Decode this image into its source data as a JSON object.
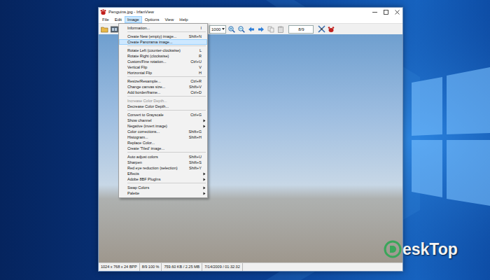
{
  "window": {
    "title": "Penguins.jpg - IrfanView"
  },
  "menubar": [
    {
      "label": "File",
      "selected": false
    },
    {
      "label": "Edit",
      "selected": false
    },
    {
      "label": "Image",
      "selected": true
    },
    {
      "label": "Options",
      "selected": false
    },
    {
      "label": "View",
      "selected": false
    },
    {
      "label": "Help",
      "selected": false
    }
  ],
  "toolbar": {
    "zoom": "1000",
    "page": "8/9"
  },
  "image_menu": [
    {
      "kind": "item",
      "label": "Information...",
      "shortcut": "I",
      "submenu": false,
      "disabled": false,
      "selected": false
    },
    {
      "kind": "separator"
    },
    {
      "kind": "item",
      "label": "Create New (empty) image...",
      "shortcut": "Shift+N",
      "submenu": false,
      "disabled": false,
      "selected": false
    },
    {
      "kind": "item",
      "label": "Create Panorama image...",
      "shortcut": "",
      "submenu": false,
      "disabled": false,
      "selected": true
    },
    {
      "kind": "separator"
    },
    {
      "kind": "item",
      "label": "Rotate Left (counter-clockwise)",
      "shortcut": "L",
      "submenu": false,
      "disabled": false,
      "selected": false
    },
    {
      "kind": "item",
      "label": "Rotate Right (clockwise)",
      "shortcut": "R",
      "submenu": false,
      "disabled": false,
      "selected": false
    },
    {
      "kind": "item",
      "label": "Custom/Fine rotation...",
      "shortcut": "Ctrl+U",
      "submenu": false,
      "disabled": false,
      "selected": false
    },
    {
      "kind": "item",
      "label": "Vertical Flip",
      "shortcut": "V",
      "submenu": false,
      "disabled": false,
      "selected": false
    },
    {
      "kind": "item",
      "label": "Horizontal Flip",
      "shortcut": "H",
      "submenu": false,
      "disabled": false,
      "selected": false
    },
    {
      "kind": "separator"
    },
    {
      "kind": "item",
      "label": "Resize/Resample...",
      "shortcut": "Ctrl+R",
      "submenu": false,
      "disabled": false,
      "selected": false
    },
    {
      "kind": "item",
      "label": "Change canvas size...",
      "shortcut": "Shift+V",
      "submenu": false,
      "disabled": false,
      "selected": false
    },
    {
      "kind": "item",
      "label": "Add border/frame...",
      "shortcut": "Ctrl+D",
      "submenu": false,
      "disabled": false,
      "selected": false
    },
    {
      "kind": "separator"
    },
    {
      "kind": "item",
      "label": "Increase Color Depth...",
      "shortcut": "",
      "submenu": false,
      "disabled": true,
      "selected": false
    },
    {
      "kind": "item",
      "label": "Decrease Color Depth...",
      "shortcut": "",
      "submenu": false,
      "disabled": false,
      "selected": false
    },
    {
      "kind": "separator"
    },
    {
      "kind": "item",
      "label": "Convert to Grayscale",
      "shortcut": "Ctrl+G",
      "submenu": false,
      "disabled": false,
      "selected": false
    },
    {
      "kind": "item",
      "label": "Show channel",
      "shortcut": "",
      "submenu": true,
      "disabled": false,
      "selected": false
    },
    {
      "kind": "item",
      "label": "Negative (invert image)",
      "shortcut": "",
      "submenu": true,
      "disabled": false,
      "selected": false
    },
    {
      "kind": "item",
      "label": "Color corrections...",
      "shortcut": "Shift+G",
      "submenu": false,
      "disabled": false,
      "selected": false
    },
    {
      "kind": "item",
      "label": "Histogram...",
      "shortcut": "Shift+H",
      "submenu": false,
      "disabled": false,
      "selected": false
    },
    {
      "kind": "item",
      "label": "Replace Color...",
      "shortcut": "",
      "submenu": false,
      "disabled": false,
      "selected": false
    },
    {
      "kind": "item",
      "label": "Create 'Tiled' image...",
      "shortcut": "",
      "submenu": false,
      "disabled": false,
      "selected": false
    },
    {
      "kind": "separator"
    },
    {
      "kind": "item",
      "label": "Auto adjust colors",
      "shortcut": "Shift+U",
      "submenu": false,
      "disabled": false,
      "selected": false
    },
    {
      "kind": "item",
      "label": "Sharpen",
      "shortcut": "Shift+S",
      "submenu": false,
      "disabled": false,
      "selected": false
    },
    {
      "kind": "item",
      "label": "Red eye reduction (selection)",
      "shortcut": "Shift+Y",
      "submenu": false,
      "disabled": false,
      "selected": false
    },
    {
      "kind": "item",
      "label": "Effects",
      "shortcut": "",
      "submenu": true,
      "disabled": false,
      "selected": false
    },
    {
      "kind": "item",
      "label": "Adobe 8BF PlugIns",
      "shortcut": "",
      "submenu": true,
      "disabled": false,
      "selected": false
    },
    {
      "kind": "separator"
    },
    {
      "kind": "item",
      "label": "Swap Colors",
      "shortcut": "",
      "submenu": true,
      "disabled": false,
      "selected": false
    },
    {
      "kind": "item",
      "label": "Palette",
      "shortcut": "",
      "submenu": true,
      "disabled": false,
      "selected": false
    }
  ],
  "status_bar": [
    "1024 x 768 x 24 BPP",
    "8/9  100 %",
    "759.60 KB / 2.25 MB",
    "7/14/2009 / 01:32:32"
  ],
  "watermark": {
    "text": "eskTop"
  }
}
